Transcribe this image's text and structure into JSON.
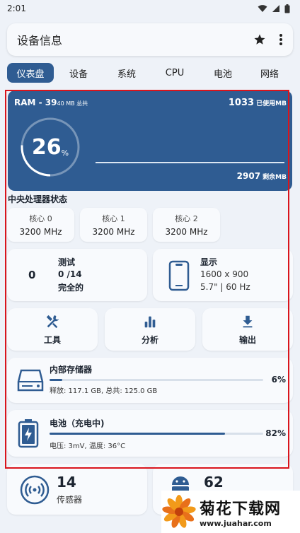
{
  "status_bar": {
    "time": "2:01"
  },
  "app_bar": {
    "title": "设备信息"
  },
  "tabs": [
    {
      "label": "仪表盘",
      "active": true
    },
    {
      "label": "设备"
    },
    {
      "label": "系统"
    },
    {
      "label": "CPU"
    },
    {
      "label": "电池"
    },
    {
      "label": "网络"
    }
  ],
  "ram": {
    "title": "RAM - 39",
    "title_suffix": "40 MB 总共",
    "used_value": "1033",
    "used_unit": " 已使用MB",
    "percent": "26",
    "percent_sign": "%",
    "percent_fraction": 0.26,
    "free_value": "2907",
    "free_unit": " 剩余MB"
  },
  "cpu": {
    "section_title": "中央处理器状态",
    "cores": [
      {
        "name": "核心 0",
        "freq": "3200 MHz"
      },
      {
        "name": "核心 1",
        "freq": "3200 MHz"
      },
      {
        "name": "核心 2",
        "freq": "3200 MHz"
      }
    ]
  },
  "tests": {
    "count": "0",
    "label": "测试",
    "progress": "0 /14",
    "status": "完全的"
  },
  "display": {
    "label": "显示",
    "resolution": "1600 x 900",
    "size": "5.7\" | 60 Hz"
  },
  "tools": [
    {
      "label": "工具",
      "icon": "tools-icon"
    },
    {
      "label": "分析",
      "icon": "chart-icon"
    },
    {
      "label": "输出",
      "icon": "download-icon"
    }
  ],
  "storage": {
    "title": "内部存储器",
    "percent": "6%",
    "fraction": 0.06,
    "detail": "释放: 117.1 GB,  总共: 125.0 GB"
  },
  "battery": {
    "title": "电池（充电中)",
    "percent": "82%",
    "fraction": 0.82,
    "detail": "电压: 3mV,  温度: 36°C"
  },
  "sensors": {
    "count": "14",
    "label": "传感器"
  },
  "apps": {
    "count": "62"
  },
  "watermark": {
    "text": "菊花下载网",
    "url": "www.juahar.com"
  },
  "colors": {
    "accent": "#2f5c92",
    "highlight_frame": "#d9141c",
    "background": "#eef2f8"
  }
}
